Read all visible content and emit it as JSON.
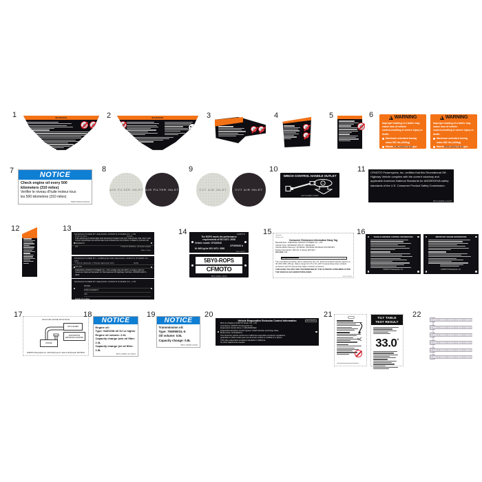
{
  "page": {
    "title": "CFMOTO Decal / Label Parts Diagram",
    "background": "#ffffff",
    "accent_orange": "#f47216",
    "accent_blue": "#0f7fd4",
    "label_black": "#111014"
  },
  "callouts": [
    "1",
    "2",
    "3",
    "4",
    "5",
    "6",
    "7",
    "8",
    "9",
    "10",
    "11",
    "12",
    "13",
    "14",
    "15",
    "16",
    "17",
    "18",
    "19",
    "20",
    "21",
    "22"
  ],
  "items": {
    "i1": {
      "num": "1",
      "name": "operation-warning-decal-left",
      "header": "WARNING",
      "pictograms": [
        "no-passenger-icon",
        "seatbelt-icon"
      ]
    },
    "i2": {
      "num": "2",
      "name": "operation-warning-decal-right",
      "header": "WARNING",
      "pictograms": [
        "no-entry-icon",
        "helmet-icon"
      ]
    },
    "i3": {
      "num": "3",
      "name": "bowtie-warning-decal",
      "header": "WARNING",
      "pictograms": [
        "warning-circle-1",
        "warning-circle-2"
      ]
    },
    "i4": {
      "num": "4",
      "name": "trapezoid-warning-decal",
      "header": "WARNING",
      "pictograms": [
        "no-rider-icon",
        "no-tow-icon"
      ]
    },
    "i5": {
      "num": "5",
      "name": "tall-warning-decal",
      "header": "WARNING",
      "pictograms": [
        "prohibition-icon"
      ]
    },
    "i6": {
      "num": "6",
      "name": "trailer-loading-warning-pair",
      "labels": [
        {
          "header": "WARNING",
          "intro": "Improper loading of a trailer may cause loss of vehicle control,resulting in severe injury or death.",
          "bullets": [
            "Maximum unbraked towing mass 551 lbs (250kg)",
            "Maximum unbraked tongue mass 55 lbs (25kg)"
          ],
          "part_no": "5HY0-190806   US166"
        },
        {
          "header": "WARNING",
          "intro": "Improper loading of a trailer may cause loss of vehicle control,resulting in severe injury or death.",
          "bullets": [
            "Maximum unbraked towing mass 882 lbs (400kg)",
            "Maximum unbraked tongue mass 88 lbs (40kg)"
          ],
          "part_no": "5BY0-190802   US166"
        }
      ]
    },
    "i7": {
      "num": "7",
      "name": "engine-oil-notice-decal",
      "header": "NOTICE",
      "lines": [
        "Check engine oil every 500",
        "kilometers (310 miles)",
        "Verifier le niveau d'huile moteur tous",
        "les 500 kilometres (310  miles)"
      ],
      "part_no": "5058-190413-05130"
    },
    "i8": {
      "num": "8",
      "name": "air-filter-inlet-decal-pair",
      "text": "AIR FILTER INLET",
      "variants": [
        "light",
        "dark"
      ]
    },
    "i9": {
      "num": "9",
      "name": "cvt-air-inlet-decal-pair",
      "text": "CVT AIR INLET",
      "variants": [
        "light",
        "dark"
      ]
    },
    "i10": {
      "num": "10",
      "name": "winch-control-handle-outlet-decal",
      "title": "WINCH CONTROL HANDLE OUTLET",
      "part_no": "5HY0-190921   US182",
      "pictograms": [
        "winch-plug-icon",
        "socket-icon",
        "down-arrow-icon"
      ]
    },
    "i11": {
      "num": "11",
      "name": "ansi-rohva-certification-decal",
      "text": "CFMOTO Powersports, Inc. certifies that this Recreational Off-Highway Vehicle complies with the current voluntary and applicable American National Standards for ANSI/ROHVA safety standards of the U.S. Consumer Product Safety Commission.",
      "part_no": "5BY0-190895-A  US178"
    },
    "i12": {
      "num": "12",
      "name": "vertical-warning-strip-decal",
      "header": "WARNING"
    },
    "i13": {
      "num": "13",
      "name": "vin-manufacturer-plates",
      "plates": [
        {
          "header": "MANUFACTURED BY  ZHEJIANG CFMOTO POWER CO., LTD",
          "fields": [
            "DATE OF MFG.",
            "MODEL"
          ],
          "note": "THIS VEHICLE IS DESIGNED AND MANUFACTURED FOR OFF-THE-ROAD USE ONLY AND IS NOT EQUIPPED OR APPROVED FOR OPERATION ON PUBLIC STREETS, ROADS OR HIGHWAYS",
          "footer_left": "VIN",
          "footer_right": "TYPE OF VEHICLE : All Terrain Vehicle",
          "origin": "Made in China"
        },
        {
          "header": "MANUFACTURED BY / FABRIQUE PAR  ZHEJIANG CFMOTO POWER CO., LTD",
          "fields": [
            "TYPE OF VEHICLE / TYPE DE VEHICULE: ROV",
            "DATE"
          ],
          "note": "ZHEJIANG CFMOTO POWER CO., LTD certifies that this ROV complies with the American National Standard for Recreational Off-Highway Vehicles, ANSI/ROHVA 1-2016.",
          "footer_left": "VIN /NIV"
        },
        {
          "header": "MANUFACTURED BY  ZHEJIANG CFMOTO POWER CO., LTD",
          "fields": [
            "MODEL",
            "DISPLACEMENT:",
            "VIN"
          ],
          "footer_left": "MADE IN CHINA"
        }
      ]
    },
    "i14": {
      "num": "14",
      "name": "rops-certification-plate",
      "brand_small": "CFMOTO",
      "lines": [
        "The ROPS meets the performance",
        "requirements of ISO 3471: 2008",
        "Vehicle model: CF1000US",
        "CF1000US  A",
        "M: 845 kg for ISO 3471: 2008"
      ],
      "part_no": "5BY0-190901",
      "badge_code": "5BY0-ROPS",
      "badge_brand": "CFMOTO",
      "badge_part_no": "5BY0-190901   US190"
    },
    "i15": {
      "num": "15",
      "name": "emission-information-hang-tag",
      "title": "Consumer Emissions Information Hang Tag",
      "rows": [
        "Manufacturer:  ZHEJIANG CFMOTO POWER CO., LTD",
        "Vehicle Type:  OFFROAD UTILITY VEHICLES",
        "Vehicle Model Name(s):  CFORCE/ UFORCE/ ZFORCE/ SSV/SPORT",
        "Engine Description:  962.4cc 4 Stroke With EFI"
      ],
      "scale_label_left": "Most Clean",
      "scale_label_right": "Least Clean",
      "scale_value": "HC+NOx: 1.0",
      "note": "The normalized emission rate is defined by the U.S. Environmental Protection Agency in 40 CFR 1051.135 (g). Values range from 5 to 15, with 5 representing lower exhaust emissions and 15 representing higher exhaust emissions.",
      "footer": "THIS HANG TAG MAY ONLY BE REMOVED BY THE ULTIMATE CONSUMER AFTER THE VEHICLE HAS BEEN PURCHASED.",
      "part_no": "5BY0-190910"
    },
    "i16": {
      "num": "16",
      "name": "emission-control-information-plates",
      "plates": [
        {
          "title": "VEHICLE EMISSION CONTROL INFORMATION",
          "footer": "CFMOTO Powersports, Inc."
        },
        {
          "title": "IMPORTANT ENGINE INFORMATION",
          "footer": "CFMOTO Powersports, Inc."
        }
      ]
    },
    "i17": {
      "num": "17",
      "name": "vacuum-hose-routing-decal",
      "title": "VACUUM HOSE ROUTING",
      "boxes": [
        {
          "label": "AIR CLEANER"
        },
        {
          "label": "EVAPORATIVE EMISSIONS CANISTER"
        },
        {
          "label": "ENGINE"
        }
      ],
      "address": "CFMOTO Powersports Inc. 3101 Holly Lane N. Suite # 10  Plymouth, MN 55447"
    },
    "i18": {
      "num": "18",
      "name": "engine-oil-spec-notice-decal",
      "header": "NOTICE",
      "lines": [
        "Engine oil:",
        "Type: SAE10W-40 SJ or higher",
        "Engine oil volume:  2.6L",
        "Capacity change (w/o oil filter: 2.4L",
        "Capacity change (w/ oil filter: 2.5L"
      ],
      "part_no": "5BY0-190507-20   US001"
    },
    "i19": {
      "num": "19",
      "name": "transmission-oil-notice-decal",
      "header": "NOTICE",
      "lines": [
        "Transmission oil:",
        "Type: 75W/80/GL-5",
        "Oil volume:  0.8L",
        "Capacity change: 0.8L"
      ],
      "part_no": "5BY0-190506   US154"
    },
    "i20": {
      "num": "20",
      "name": "evaporative-emission-control-decal",
      "title": "Vehicle Evaporative Emission Control Information",
      "lines": [
        "MFG by Zhejiang CFMOTO Power CO.,  LTD",
        "Imported by CFMOTO Powersports Inc.",
        "Evaporative Family Name:  LCMAX0960XEF",
        "Evaporative Emission Control System:  EVAP Canister and Purge Valve",
        "Model name:  CF1000US  A",
        "This all terrain vehicle conforms to California evaporative emissions regulations",
        "applicable to 2020 model year new all terrain vehicle is certified on 3 grams",
        "TOG /day evaporative emissions standard in California.",
        "No other adjustments needed"
      ],
      "tag": "5BY0-190912"
    },
    "i21": {
      "num": "21",
      "name": "hangtag-and-tilt-table-result",
      "tilt": {
        "header_line1": "TILT TABLE",
        "header_line2": "TEST RESULT",
        "value": "33.0",
        "degree": "°"
      }
    },
    "i22": {
      "num": "22",
      "name": "cable-tie-set",
      "count": 6
    }
  }
}
